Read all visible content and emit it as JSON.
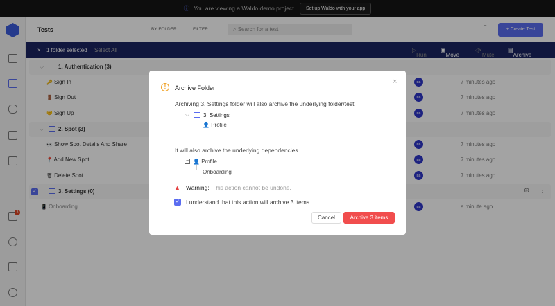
{
  "banner": {
    "text": "You are viewing a Waldo demo project.",
    "button": "Set up Waldo with your app"
  },
  "header": {
    "title": "Tests",
    "by_folder": "BY FOLDER",
    "filter": "FILTER",
    "search_placeholder": "Search for a test",
    "create": "Create Test"
  },
  "selection": {
    "count": "1 folder selected",
    "select_all": "Select All",
    "run": "Run",
    "move": "Move",
    "mute": "Mute",
    "archive": "Archive"
  },
  "sidebar": {
    "gift_badge": "3"
  },
  "tree": [
    {
      "type": "folder",
      "label": "1. Authentication (3)"
    },
    {
      "type": "test",
      "icon": "🔑",
      "label": "Sign In",
      "author": "BB",
      "time": "7 minutes ago"
    },
    {
      "type": "test",
      "icon": "🚪",
      "label": "Sign Out",
      "author": "BB",
      "time": "7 minutes ago"
    },
    {
      "type": "test",
      "icon": "🤝",
      "label": "Sign Up",
      "author": "BB",
      "time": "7 minutes ago"
    },
    {
      "type": "folder",
      "label": "2. Spot (3)"
    },
    {
      "type": "test",
      "icon": "👀",
      "label": "Show Spot Details And Share",
      "author": "BB",
      "time": "7 minutes ago"
    },
    {
      "type": "test",
      "icon": "📍",
      "label": "Add New Spot",
      "author": "BB",
      "time": "7 minutes ago"
    },
    {
      "type": "test",
      "icon": "🗑",
      "label": "Delete Spot",
      "author": "BB",
      "time": "7 minutes ago"
    },
    {
      "type": "folder",
      "label": "3. Settings (0)"
    },
    {
      "type": "test",
      "icon": "📱",
      "label": "Onboarding",
      "author": "BB",
      "time": "a minute ago"
    }
  ],
  "modal": {
    "title": "Archive Folder",
    "intro": "Archiving 3. Settings folder will also archive the underlying folder/test",
    "folder": "3. Settings",
    "folder_child": "Profile",
    "deps_intro": "It will also archive the underlying dependencies",
    "dep": "Profile",
    "dep_child": "Onboarding",
    "warning_label": "Warning:",
    "warning_text": "This action cannot be undone.",
    "confirm": "I understand that this action will archive 3 items.",
    "cancel": "Cancel",
    "submit": "Archive 3 items"
  }
}
